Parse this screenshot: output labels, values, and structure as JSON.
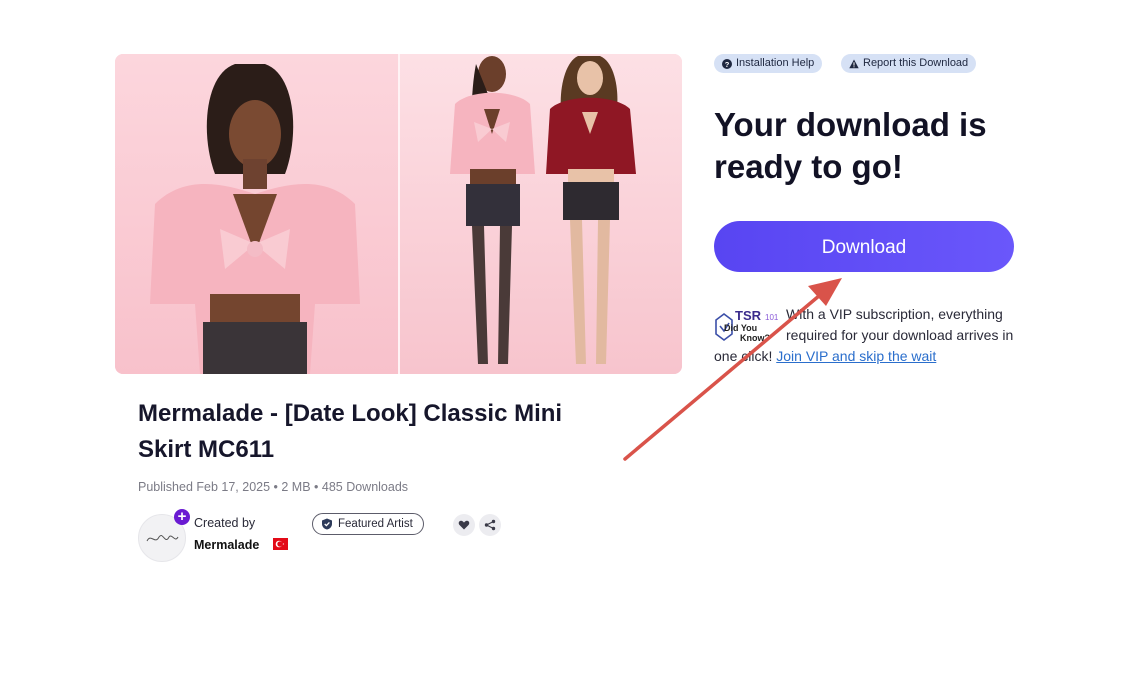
{
  "product": {
    "title": "Mermalade - [Date Look] Classic Mini Skirt MC611",
    "meta": "Published Feb 17, 2025 • 2 MB • 485 Downloads"
  },
  "creator": {
    "created_by_label": "Created by",
    "name": "Mermalade",
    "plus_badge": "+",
    "featured_label": "Featured Artist"
  },
  "actions": {
    "installation_help": "Installation Help",
    "report": "Report this Download"
  },
  "main": {
    "headline": "Your download is ready to go!",
    "download_button": "Download"
  },
  "vip": {
    "logo_text": "TSR",
    "logo_sub": "101",
    "logo_line2": "Did You",
    "logo_line3": "Know?",
    "message": "With a VIP subscription, everything required for your download arrives in one click!",
    "link": "Join VIP and skip the wait"
  },
  "colors": {
    "accent": "#5c49f5",
    "chip_bg": "#d6e1f5",
    "link": "#2a6ecc",
    "arrow": "#d9534a",
    "plus_badge": "#6a1bd2"
  }
}
